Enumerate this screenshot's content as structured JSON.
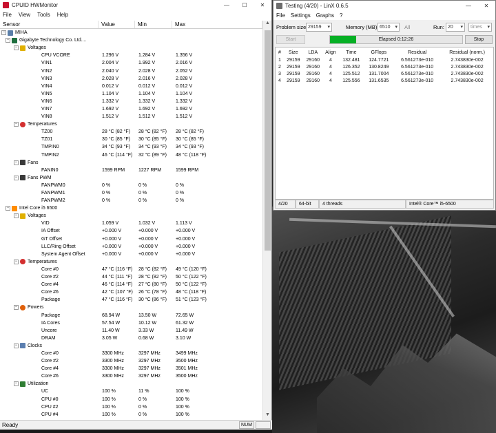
{
  "colors": {
    "hwm_icon": "#c8102e",
    "voltage_icon": "#e0b000",
    "temp_icon": "#d32f2f",
    "fan_icon": "#3a3a3a",
    "power_icon": "#e0600a",
    "clock_icon": "#5b7fb0",
    "util_icon": "#2e7d32",
    "board_icon": "#1f6f3f",
    "cpu_icon": "#ff8c00",
    "progress_fill": "#06b025"
  },
  "hwmonitor": {
    "title": "CPUID HWMonitor",
    "menu": [
      "File",
      "View",
      "Tools",
      "Help"
    ],
    "columns": [
      "Sensor",
      "Value",
      "Min",
      "Max"
    ],
    "tree": [
      {
        "kind": "root",
        "label": "MIHA",
        "icon": "computer-icon"
      },
      {
        "kind": "device",
        "label": "Gigabyte Technology Co. Ltd....",
        "icon": "motherboard-icon"
      },
      {
        "kind": "group",
        "label": "Voltages",
        "icon": "voltage-icon"
      },
      {
        "kind": "leaf",
        "label": "CPU VCORE",
        "value": "1.296 V",
        "min": "1.284 V",
        "max": "1.356 V"
      },
      {
        "kind": "leaf",
        "label": "VIN1",
        "value": "2.004 V",
        "min": "1.992 V",
        "max": "2.016 V"
      },
      {
        "kind": "leaf",
        "label": "VIN2",
        "value": "2.040 V",
        "min": "2.028 V",
        "max": "2.052 V"
      },
      {
        "kind": "leaf",
        "label": "VIN3",
        "value": "2.028 V",
        "min": "2.016 V",
        "max": "2.028 V"
      },
      {
        "kind": "leaf",
        "label": "VIN4",
        "value": "0.012 V",
        "min": "0.012 V",
        "max": "0.012 V"
      },
      {
        "kind": "leaf",
        "label": "VIN5",
        "value": "1.104 V",
        "min": "1.104 V",
        "max": "1.104 V"
      },
      {
        "kind": "leaf",
        "label": "VIN6",
        "value": "1.332 V",
        "min": "1.332 V",
        "max": "1.332 V"
      },
      {
        "kind": "leaf",
        "label": "VIN7",
        "value": "1.692 V",
        "min": "1.692 V",
        "max": "1.692 V"
      },
      {
        "kind": "leaf",
        "label": "VIN8",
        "value": "1.512 V",
        "min": "1.512 V",
        "max": "1.512 V"
      },
      {
        "kind": "group",
        "label": "Temperatures",
        "icon": "thermometer-icon"
      },
      {
        "kind": "leaf",
        "label": "TZ00",
        "value": "28 °C (82 °F)",
        "min": "28 °C (82 °F)",
        "max": "28 °C (82 °F)"
      },
      {
        "kind": "leaf",
        "label": "TZ01",
        "value": "30 °C (85 °F)",
        "min": "30 °C (85 °F)",
        "max": "30 °C (85 °F)"
      },
      {
        "kind": "leaf",
        "label": "TMPIN0",
        "value": "34 °C (93 °F)",
        "min": "34 °C (93 °F)",
        "max": "34 °C (93 °F)"
      },
      {
        "kind": "leaf",
        "label": "TMPIN2",
        "value": "46 °C (114 °F)",
        "min": "32 °C (89 °F)",
        "max": "48 °C (118 °F)"
      },
      {
        "kind": "group",
        "label": "Fans",
        "icon": "fan-icon"
      },
      {
        "kind": "leaf",
        "label": "FANIN0",
        "value": "1599 RPM",
        "min": "1227 RPM",
        "max": "1599 RPM"
      },
      {
        "kind": "group",
        "label": "Fans PWM",
        "icon": "fan-pwm-icon"
      },
      {
        "kind": "leaf",
        "label": "FANPWM0",
        "value": "0 %",
        "min": "0 %",
        "max": "0 %"
      },
      {
        "kind": "leaf",
        "label": "FANPWM1",
        "value": "0 %",
        "min": "0 %",
        "max": "0 %"
      },
      {
        "kind": "leaf",
        "label": "FANPWM2",
        "value": "0 %",
        "min": "0 %",
        "max": "0 %"
      },
      {
        "kind": "device",
        "label": "Intel Core i5 6500",
        "icon": "cpu-icon"
      },
      {
        "kind": "group",
        "label": "Voltages",
        "icon": "voltage-icon"
      },
      {
        "kind": "leaf",
        "label": "VID",
        "value": "1.059 V",
        "min": "1.032 V",
        "max": "1.113 V"
      },
      {
        "kind": "leaf",
        "label": "IA Offset",
        "value": "+0.000 V",
        "min": "+0.000 V",
        "max": "+0.000 V"
      },
      {
        "kind": "leaf",
        "label": "GT Offset",
        "value": "+0.000 V",
        "min": "+0.000 V",
        "max": "+0.000 V"
      },
      {
        "kind": "leaf",
        "label": "LLC/Ring Offset",
        "value": "+0.000 V",
        "min": "+0.000 V",
        "max": "+0.000 V"
      },
      {
        "kind": "leaf",
        "label": "System Agent Offset",
        "value": "+0.000 V",
        "min": "+0.000 V",
        "max": "+0.000 V"
      },
      {
        "kind": "group",
        "label": "Temperatures",
        "icon": "thermometer-icon"
      },
      {
        "kind": "leaf",
        "label": "Core #0",
        "value": "47 °C (116 °F)",
        "min": "28 °C (82 °F)",
        "max": "49 °C (120 °F)"
      },
      {
        "kind": "leaf",
        "label": "Core #2",
        "value": "44 °C (111 °F)",
        "min": "28 °C (82 °F)",
        "max": "50 °C (122 °F)"
      },
      {
        "kind": "leaf",
        "label": "Core #4",
        "value": "46 °C (114 °F)",
        "min": "27 °C (80 °F)",
        "max": "50 °C (122 °F)"
      },
      {
        "kind": "leaf",
        "label": "Core #6",
        "value": "42 °C (107 °F)",
        "min": "26 °C (78 °F)",
        "max": "48 °C (118 °F)"
      },
      {
        "kind": "leaf",
        "label": "Package",
        "value": "47 °C (116 °F)",
        "min": "30 °C (86 °F)",
        "max": "51 °C (123 °F)"
      },
      {
        "kind": "group",
        "label": "Powers",
        "icon": "power-icon"
      },
      {
        "kind": "leaf",
        "label": "Package",
        "value": "68.94 W",
        "min": "13.50 W",
        "max": "72.65 W"
      },
      {
        "kind": "leaf",
        "label": "IA Cores",
        "value": "57.54 W",
        "min": "10.12 W",
        "max": "61.32 W"
      },
      {
        "kind": "leaf",
        "label": "Uncore",
        "value": "11.40 W",
        "min": "3.33 W",
        "max": "11.49 W"
      },
      {
        "kind": "leaf",
        "label": "DRAM",
        "value": "3.05 W",
        "min": "0.68 W",
        "max": "3.10 W"
      },
      {
        "kind": "group",
        "label": "Clocks",
        "icon": "clock-icon"
      },
      {
        "kind": "leaf",
        "label": "Core #0",
        "value": "3300 MHz",
        "min": "3297 MHz",
        "max": "3499 MHz"
      },
      {
        "kind": "leaf",
        "label": "Core #2",
        "value": "3300 MHz",
        "min": "3297 MHz",
        "max": "3500 MHz"
      },
      {
        "kind": "leaf",
        "label": "Core #4",
        "value": "3300 MHz",
        "min": "3297 MHz",
        "max": "3501 MHz"
      },
      {
        "kind": "leaf",
        "label": "Core #6",
        "value": "3300 MHz",
        "min": "3297 MHz",
        "max": "3500 MHz"
      },
      {
        "kind": "group",
        "label": "Utilization",
        "icon": "utilization-icon"
      },
      {
        "kind": "leaf",
        "label": "UC",
        "value": "100 %",
        "min": "11 %",
        "max": "100 %"
      },
      {
        "kind": "leaf",
        "label": "CPU #0",
        "value": "100 %",
        "min": "0 %",
        "max": "100 %"
      },
      {
        "kind": "leaf",
        "label": "CPU #2",
        "value": "100 %",
        "min": "0 %",
        "max": "100 %"
      },
      {
        "kind": "leaf",
        "label": "CPU #4",
        "value": "100 %",
        "min": "0 %",
        "max": "100 %"
      }
    ],
    "status": {
      "ready": "Ready",
      "num": "NUM"
    }
  },
  "linx": {
    "title": "Testing (4/20) - LinX 0.6.5",
    "menu": [
      "File",
      "Settings",
      "Graphs",
      "?"
    ],
    "problem_size_label": "Problem size:",
    "problem_size": "29159",
    "memory_label": "Memory (MB):",
    "memory": "6510",
    "all_label": "All",
    "run_label": "Run:",
    "run": "20",
    "times": "times",
    "start_label": "Start",
    "stop_label": "Stop",
    "progress_text": "Elapsed 0:12:26",
    "progress_fraction": 0.2,
    "columns": [
      "#",
      "Size",
      "LDA",
      "Align",
      "Time",
      "GFlops",
      "Residual",
      "Residual (norm.)"
    ],
    "rows": [
      [
        "1",
        "29159",
        "29160",
        "4",
        "132.481",
        "124.7721",
        "6.561273e-010",
        "2.743830e-002"
      ],
      [
        "2",
        "29159",
        "29160",
        "4",
        "126.352",
        "130.8249",
        "6.561273e-010",
        "2.743830e-002"
      ],
      [
        "3",
        "29159",
        "29160",
        "4",
        "125.512",
        "131.7004",
        "6.561273e-010",
        "2.743830e-002"
      ],
      [
        "4",
        "29159",
        "29160",
        "4",
        "125.556",
        "131.6535",
        "6.561273e-010",
        "2.743830e-002"
      ]
    ],
    "status": {
      "run": "4/20",
      "bits": "64-bit",
      "threads": "4 threads",
      "cpu": "Intel® Core™ i5-6500"
    }
  }
}
